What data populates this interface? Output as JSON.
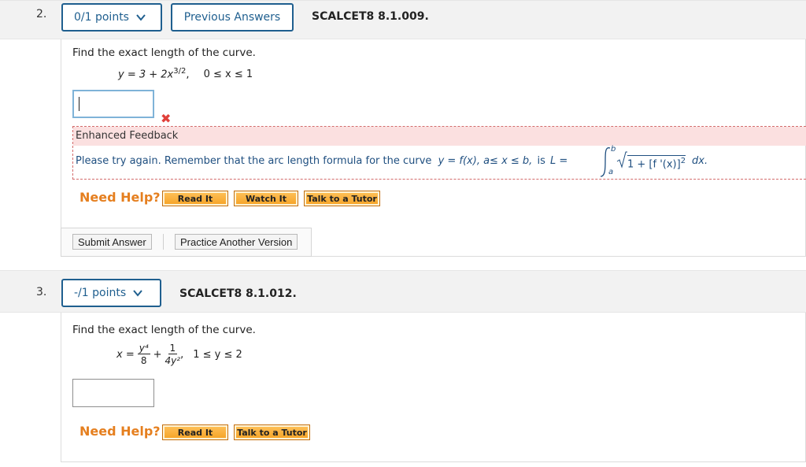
{
  "q2": {
    "number": "2.",
    "points_label": "0/1 points",
    "prev_answers_label": "Previous Answers",
    "code": "SCALCET8 8.1.009.",
    "prompt": "Find the exact length of the curve.",
    "equation": "y = 3 + 2x",
    "equation_exp": "3/2",
    "equation_sep": ",",
    "domain": "0 ≤ x ≤ 1",
    "feedback_title": "Enhanced Feedback",
    "feedback_text": "Please try again. Remember that the arc length formula for the curve",
    "feedback_curve": "y = f(x), a≤ x ≤ b,",
    "feedback_is": "is",
    "feedback_L": "L =",
    "feedback_upper": "b",
    "feedback_lower": "a",
    "feedback_integrand": "1 + [f '(x)]",
    "feedback_integrand_exp": "2",
    "feedback_dx": "dx.",
    "need_help": "Need Help?",
    "read_it": "Read It",
    "watch_it": "Watch It",
    "talk_tutor": "Talk to a Tutor",
    "submit": "Submit Answer",
    "practice": "Practice Another Version"
  },
  "q3": {
    "number": "3.",
    "points_label": "-/1 points",
    "code": "SCALCET8 8.1.012.",
    "prompt": "Find the exact length of the curve.",
    "eq_x": "x =",
    "eq_num1": "y⁴",
    "eq_den1": "8",
    "eq_plus": "+",
    "eq_num2": "1",
    "eq_den2": "4y²",
    "eq_comma": ",",
    "domain": "1 ≤ y ≤ 2",
    "need_help": "Need Help?",
    "read_it": "Read It",
    "talk_tutor": "Talk to a Tutor"
  },
  "colors": {
    "accent": "#1f5f8f",
    "help_orange": "#e57f1f",
    "error_red": "#e0403a",
    "feedback_bg": "#fbe0e0",
    "feedback_text": "#1f4f80"
  }
}
